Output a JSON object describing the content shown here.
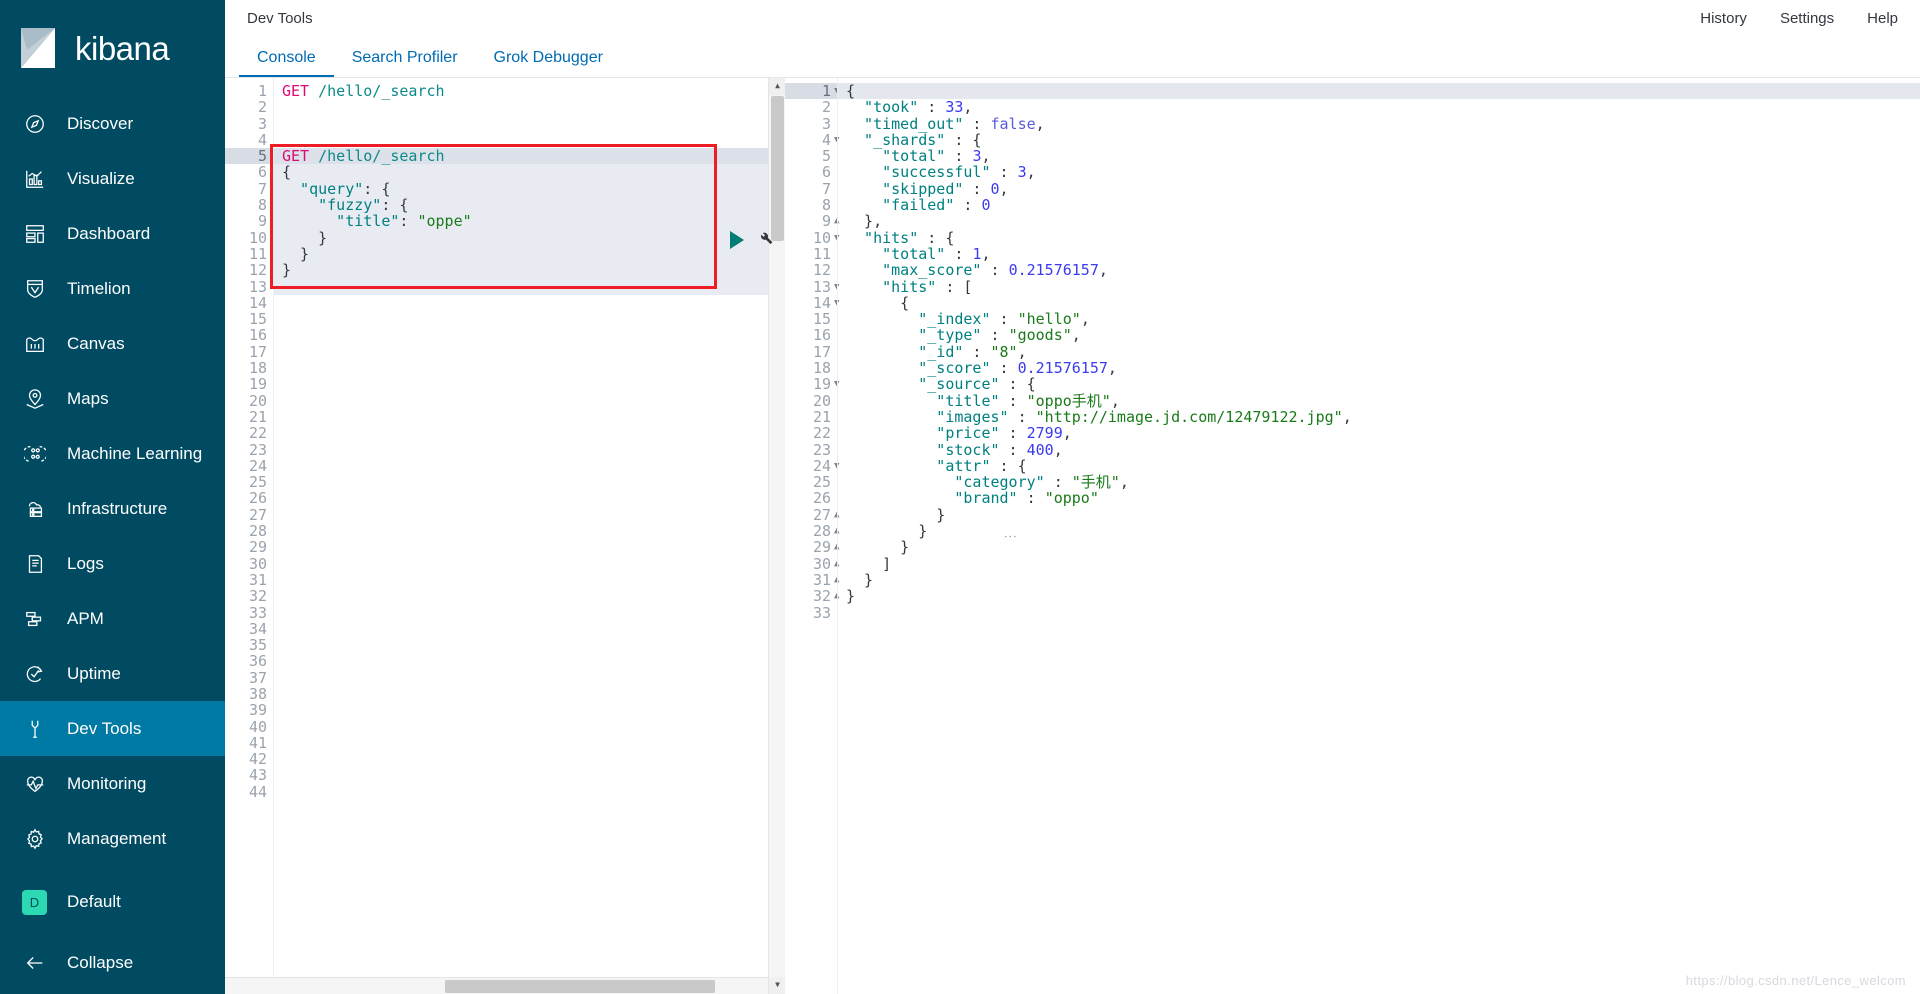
{
  "app": {
    "name": "kibana"
  },
  "header": {
    "title": "Dev Tools",
    "actions": [
      {
        "label": "History"
      },
      {
        "label": "Settings"
      },
      {
        "label": "Help"
      }
    ]
  },
  "tabs": [
    {
      "label": "Console",
      "active": true
    },
    {
      "label": "Search Profiler",
      "active": false
    },
    {
      "label": "Grok Debugger",
      "active": false
    }
  ],
  "sidebar": {
    "items": [
      {
        "label": "Discover",
        "icon": "compass-icon",
        "active": false
      },
      {
        "label": "Visualize",
        "icon": "visualize-icon",
        "active": false
      },
      {
        "label": "Dashboard",
        "icon": "dashboard-icon",
        "active": false
      },
      {
        "label": "Timelion",
        "icon": "timelion-icon",
        "active": false
      },
      {
        "label": "Canvas",
        "icon": "canvas-icon",
        "active": false
      },
      {
        "label": "Maps",
        "icon": "map-marker-icon",
        "active": false
      },
      {
        "label": "Machine Learning",
        "icon": "machine-learning-icon",
        "active": false
      },
      {
        "label": "Infrastructure",
        "icon": "infrastructure-icon",
        "active": false
      },
      {
        "label": "Logs",
        "icon": "logs-icon",
        "active": false
      },
      {
        "label": "APM",
        "icon": "apm-icon",
        "active": false
      },
      {
        "label": "Uptime",
        "icon": "uptime-icon",
        "active": false
      },
      {
        "label": "Dev Tools",
        "icon": "wrench-icon",
        "active": true
      },
      {
        "label": "Monitoring",
        "icon": "monitoring-icon",
        "active": false
      },
      {
        "label": "Management",
        "icon": "gear-icon",
        "active": false
      }
    ],
    "space": {
      "label": "Default",
      "initial": "D"
    },
    "collapse": {
      "label": "Collapse",
      "icon": "arrow-left-icon"
    }
  },
  "editor": {
    "current_line": 5,
    "line_numbers": [
      1,
      2,
      3,
      4,
      5,
      6,
      7,
      8,
      9,
      10,
      11,
      12,
      13,
      14,
      15,
      16,
      17,
      18,
      19,
      20,
      21,
      22,
      23,
      24,
      25,
      26,
      27,
      28,
      29,
      30,
      31,
      32,
      33,
      34,
      35,
      36,
      37,
      38,
      39,
      40,
      41,
      42,
      43,
      44
    ],
    "folds": {
      "6": "down",
      "7": "down",
      "8": "down",
      "10": "up",
      "11": "up",
      "12": "up"
    },
    "lines": [
      {
        "n": 1,
        "tokens": [
          {
            "t": "method",
            "v": "GET"
          },
          {
            "t": "punc",
            "v": " "
          },
          {
            "t": "url",
            "v": "/hello/_search"
          }
        ]
      },
      {
        "n": 2,
        "tokens": []
      },
      {
        "n": 3,
        "tokens": []
      },
      {
        "n": 4,
        "tokens": []
      },
      {
        "n": 5,
        "tokens": [
          {
            "t": "method",
            "v": "GET"
          },
          {
            "t": "punc",
            "v": " "
          },
          {
            "t": "url",
            "v": "/hello/_search"
          }
        ]
      },
      {
        "n": 6,
        "tokens": [
          {
            "t": "punc",
            "v": "{"
          }
        ]
      },
      {
        "n": 7,
        "tokens": [
          {
            "t": "key",
            "v": "  \"query\""
          },
          {
            "t": "punc",
            "v": ": {"
          }
        ]
      },
      {
        "n": 8,
        "tokens": [
          {
            "t": "key",
            "v": "    \"fuzzy\""
          },
          {
            "t": "punc",
            "v": ": {"
          }
        ]
      },
      {
        "n": 9,
        "tokens": [
          {
            "t": "key",
            "v": "      \"title\""
          },
          {
            "t": "punc",
            "v": ": "
          },
          {
            "t": "str",
            "v": "\"oppe\""
          }
        ]
      },
      {
        "n": 10,
        "tokens": [
          {
            "t": "punc",
            "v": "    }"
          }
        ]
      },
      {
        "n": 11,
        "tokens": [
          {
            "t": "punc",
            "v": "  }"
          }
        ]
      },
      {
        "n": 12,
        "tokens": [
          {
            "t": "punc",
            "v": "}"
          }
        ]
      },
      {
        "n": 13,
        "tokens": []
      }
    ],
    "run_button": "run-query-button",
    "wrench_button": "wrench-menu-button"
  },
  "response": {
    "current_line": 1,
    "line_numbers": [
      1,
      2,
      3,
      4,
      5,
      6,
      7,
      8,
      9,
      10,
      11,
      12,
      13,
      14,
      15,
      16,
      17,
      18,
      19,
      20,
      21,
      22,
      23,
      24,
      25,
      26,
      27,
      28,
      29,
      30,
      31,
      32,
      33
    ],
    "folds": {
      "1": "down",
      "4": "down",
      "9": "up",
      "10": "down",
      "13": "down",
      "14": "down",
      "19": "down",
      "24": "down",
      "27": "up",
      "28": "up",
      "29": "up",
      "30": "up",
      "31": "up",
      "32": "up"
    },
    "lines": [
      {
        "n": 1,
        "tokens": [
          {
            "t": "punc",
            "v": "{"
          }
        ]
      },
      {
        "n": 2,
        "tokens": [
          {
            "t": "key",
            "v": "  \"took\""
          },
          {
            "t": "punc",
            "v": " : "
          },
          {
            "t": "num",
            "v": "33"
          },
          {
            "t": "punc",
            "v": ","
          }
        ]
      },
      {
        "n": 3,
        "tokens": [
          {
            "t": "key",
            "v": "  \"timed_out\""
          },
          {
            "t": "punc",
            "v": " : "
          },
          {
            "t": "bool",
            "v": "false"
          },
          {
            "t": "punc",
            "v": ","
          }
        ]
      },
      {
        "n": 4,
        "tokens": [
          {
            "t": "key",
            "v": "  \"_shards\""
          },
          {
            "t": "punc",
            "v": " : {"
          }
        ]
      },
      {
        "n": 5,
        "tokens": [
          {
            "t": "key",
            "v": "    \"total\""
          },
          {
            "t": "punc",
            "v": " : "
          },
          {
            "t": "num",
            "v": "3"
          },
          {
            "t": "punc",
            "v": ","
          }
        ]
      },
      {
        "n": 6,
        "tokens": [
          {
            "t": "key",
            "v": "    \"successful\""
          },
          {
            "t": "punc",
            "v": " : "
          },
          {
            "t": "num",
            "v": "3"
          },
          {
            "t": "punc",
            "v": ","
          }
        ]
      },
      {
        "n": 7,
        "tokens": [
          {
            "t": "key",
            "v": "    \"skipped\""
          },
          {
            "t": "punc",
            "v": " : "
          },
          {
            "t": "num",
            "v": "0"
          },
          {
            "t": "punc",
            "v": ","
          }
        ]
      },
      {
        "n": 8,
        "tokens": [
          {
            "t": "key",
            "v": "    \"failed\""
          },
          {
            "t": "punc",
            "v": " : "
          },
          {
            "t": "num",
            "v": "0"
          }
        ]
      },
      {
        "n": 9,
        "tokens": [
          {
            "t": "punc",
            "v": "  },"
          }
        ]
      },
      {
        "n": 10,
        "tokens": [
          {
            "t": "key",
            "v": "  \"hits\""
          },
          {
            "t": "punc",
            "v": " : {"
          }
        ]
      },
      {
        "n": 11,
        "tokens": [
          {
            "t": "key",
            "v": "    \"total\""
          },
          {
            "t": "punc",
            "v": " : "
          },
          {
            "t": "num",
            "v": "1"
          },
          {
            "t": "punc",
            "v": ","
          }
        ]
      },
      {
        "n": 12,
        "tokens": [
          {
            "t": "key",
            "v": "    \"max_score\""
          },
          {
            "t": "punc",
            "v": " : "
          },
          {
            "t": "num",
            "v": "0.21576157"
          },
          {
            "t": "punc",
            "v": ","
          }
        ]
      },
      {
        "n": 13,
        "tokens": [
          {
            "t": "key",
            "v": "    \"hits\""
          },
          {
            "t": "punc",
            "v": " : ["
          }
        ]
      },
      {
        "n": 14,
        "tokens": [
          {
            "t": "punc",
            "v": "      {"
          }
        ]
      },
      {
        "n": 15,
        "tokens": [
          {
            "t": "key",
            "v": "        \"_index\""
          },
          {
            "t": "punc",
            "v": " : "
          },
          {
            "t": "str",
            "v": "\"hello\""
          },
          {
            "t": "punc",
            "v": ","
          }
        ]
      },
      {
        "n": 16,
        "tokens": [
          {
            "t": "key",
            "v": "        \"_type\""
          },
          {
            "t": "punc",
            "v": " : "
          },
          {
            "t": "str",
            "v": "\"goods\""
          },
          {
            "t": "punc",
            "v": ","
          }
        ]
      },
      {
        "n": 17,
        "tokens": [
          {
            "t": "key",
            "v": "        \"_id\""
          },
          {
            "t": "punc",
            "v": " : "
          },
          {
            "t": "str",
            "v": "\"8\""
          },
          {
            "t": "punc",
            "v": ","
          }
        ]
      },
      {
        "n": 18,
        "tokens": [
          {
            "t": "key",
            "v": "        \"_score\""
          },
          {
            "t": "punc",
            "v": " : "
          },
          {
            "t": "num",
            "v": "0.21576157"
          },
          {
            "t": "punc",
            "v": ","
          }
        ]
      },
      {
        "n": 19,
        "tokens": [
          {
            "t": "key",
            "v": "        \"_source\""
          },
          {
            "t": "punc",
            "v": " : {"
          }
        ]
      },
      {
        "n": 20,
        "tokens": [
          {
            "t": "key",
            "v": "          \"title\""
          },
          {
            "t": "punc",
            "v": " : "
          },
          {
            "t": "str",
            "v": "\"oppo手机\""
          },
          {
            "t": "punc",
            "v": ","
          }
        ]
      },
      {
        "n": 21,
        "tokens": [
          {
            "t": "key",
            "v": "          \"images\""
          },
          {
            "t": "punc",
            "v": " : "
          },
          {
            "t": "str",
            "v": "\"http://image.jd.com/12479122.jpg\""
          },
          {
            "t": "punc",
            "v": ","
          }
        ]
      },
      {
        "n": 22,
        "tokens": [
          {
            "t": "key",
            "v": "          \"price\""
          },
          {
            "t": "punc",
            "v": " : "
          },
          {
            "t": "num",
            "v": "2799"
          },
          {
            "t": "punc",
            "v": ","
          }
        ]
      },
      {
        "n": 23,
        "tokens": [
          {
            "t": "key",
            "v": "          \"stock\""
          },
          {
            "t": "punc",
            "v": " : "
          },
          {
            "t": "num",
            "v": "400"
          },
          {
            "t": "punc",
            "v": ","
          }
        ]
      },
      {
        "n": 24,
        "tokens": [
          {
            "t": "key",
            "v": "          \"attr\""
          },
          {
            "t": "punc",
            "v": " : {"
          }
        ]
      },
      {
        "n": 25,
        "tokens": [
          {
            "t": "key",
            "v": "            \"category\""
          },
          {
            "t": "punc",
            "v": " : "
          },
          {
            "t": "str",
            "v": "\"手机\""
          },
          {
            "t": "punc",
            "v": ","
          }
        ]
      },
      {
        "n": 26,
        "tokens": [
          {
            "t": "key",
            "v": "            \"brand\""
          },
          {
            "t": "punc",
            "v": " : "
          },
          {
            "t": "str",
            "v": "\"oppo\""
          }
        ]
      },
      {
        "n": 27,
        "tokens": [
          {
            "t": "punc",
            "v": "          }"
          }
        ]
      },
      {
        "n": 28,
        "tokens": [
          {
            "t": "punc",
            "v": "        }"
          }
        ]
      },
      {
        "n": 29,
        "tokens": [
          {
            "t": "punc",
            "v": "      }"
          }
        ]
      },
      {
        "n": 30,
        "tokens": [
          {
            "t": "punc",
            "v": "    ]"
          }
        ]
      },
      {
        "n": 31,
        "tokens": [
          {
            "t": "punc",
            "v": "  }"
          }
        ]
      },
      {
        "n": 32,
        "tokens": [
          {
            "t": "punc",
            "v": "}"
          }
        ]
      },
      {
        "n": 33,
        "tokens": []
      }
    ]
  },
  "watermark": {
    "text": "https://blog.csdn.net/Lence_welcom"
  },
  "colors": {
    "sidebar_bg": "#014b62",
    "sidebar_active": "#0079a5",
    "link": "#006bb4",
    "accent_teal": "#017d73",
    "space_badge": "#2bd9b3",
    "annotation_red": "#ee1c25",
    "method": "#dd0a73",
    "url": "#0c8a8a",
    "json_key": "#008080",
    "json_string": "#1a7a1a",
    "json_number": "#3a3af0"
  }
}
